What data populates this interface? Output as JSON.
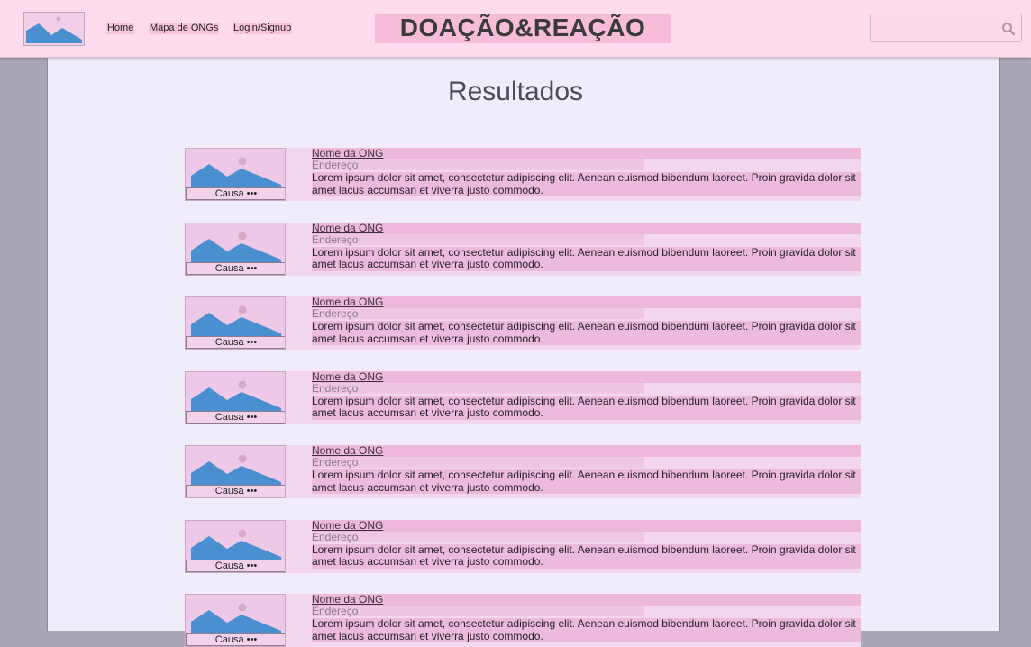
{
  "header": {
    "logo_icon": "image-placeholder-icon",
    "nav": [
      "Home",
      "Mapa de ONGs",
      "Login/Signup"
    ],
    "title": "DOAÇÃO&REAÇÃO",
    "search": {
      "value": "",
      "placeholder": "",
      "icon": "search-icon"
    }
  },
  "main": {
    "title": "Resultados",
    "results": [
      {
        "name": "Nome da ONG",
        "address": "Endereço",
        "description": "Lorem ipsum dolor sit amet, consectetur adipiscing elit. Aenean euismod bibendum laoreet. Proin gravida dolor sit amet lacus accumsan et viverra justo commodo.",
        "cause": "Causa •••"
      },
      {
        "name": "Nome da ONG",
        "address": "Endereço",
        "description": "Lorem ipsum dolor sit amet, consectetur adipiscing elit. Aenean euismod bibendum laoreet. Proin gravida dolor sit amet lacus accumsan et viverra justo commodo.",
        "cause": "Causa •••"
      },
      {
        "name": "Nome da ONG",
        "address": "Endereço",
        "description": "Lorem ipsum dolor sit amet, consectetur adipiscing elit. Aenean euismod bibendum laoreet. Proin gravida dolor sit amet lacus accumsan et viverra justo commodo.",
        "cause": "Causa •••"
      },
      {
        "name": "Nome da ONG",
        "address": "Endereço",
        "description": "Lorem ipsum dolor sit amet, consectetur adipiscing elit. Aenean euismod bibendum laoreet. Proin gravida dolor sit amet lacus accumsan et viverra justo commodo.",
        "cause": "Causa •••"
      },
      {
        "name": "Nome da ONG",
        "address": "Endereço",
        "description": "Lorem ipsum dolor sit amet, consectetur adipiscing elit. Aenean euismod bibendum laoreet. Proin gravida dolor sit amet lacus accumsan et viverra justo commodo.",
        "cause": "Causa •••"
      },
      {
        "name": "Nome da ONG",
        "address": "Endereço",
        "description": "Lorem ipsum dolor sit amet, consectetur adipiscing elit. Aenean euismod bibendum laoreet. Proin gravida dolor sit amet lacus accumsan et viverra justo commodo.",
        "cause": "Causa •••"
      },
      {
        "name": "Nome da ONG",
        "address": "Endereço",
        "description": "Lorem ipsum dolor sit amet, consectetur adipiscing elit. Aenean euismod bibendum laoreet. Proin gravida dolor sit amet lacus accumsan et viverra justo commodo.",
        "cause": "Causa •••"
      }
    ]
  },
  "colors": {
    "header_bg": "#fedcee",
    "page_bg": "#f0ecf9",
    "side_bg": "#aaa6b6",
    "accent_pink": "#f7bcd8",
    "image_blue": "#4a8fd0"
  }
}
